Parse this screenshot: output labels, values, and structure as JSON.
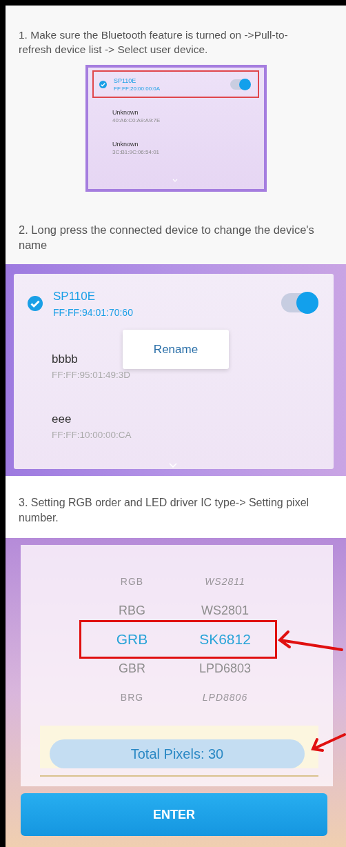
{
  "step1": {
    "text": "1. Make sure the Bluetooth feature is turned on ->Pull-to-refresh device list -> Select user device.",
    "devices": [
      {
        "name": "SP110E",
        "address": "FF:FF:20:00:00:0A",
        "selected": true,
        "connected": true,
        "highlighted": true
      },
      {
        "name": "Unknown",
        "address": "40:A6:C0:A9:A9:7E",
        "selected": false,
        "connected": false,
        "highlighted": false
      },
      {
        "name": "Unknown",
        "address": "3C:B1:9C:06:54:01",
        "selected": false,
        "connected": false,
        "highlighted": false
      }
    ]
  },
  "step2": {
    "text": "2. Long press the connected device to change the device's name",
    "devices": [
      {
        "name": "SP110E",
        "address": "FF:FF:94:01:70:60",
        "selected": true,
        "connected": true
      },
      {
        "name": "bbbb",
        "address": "FF:FF:95:01:49:3D",
        "selected": false,
        "connected": false
      },
      {
        "name": "eee",
        "address": "FF:FF:10:00:00:CA",
        "selected": false,
        "connected": false
      }
    ],
    "menu": {
      "label": "Rename"
    }
  },
  "step3": {
    "text": "3. Setting RGB order and LED driver IC type-> Setting pixel number.",
    "orders": [
      {
        "label": "RGB",
        "selected": false
      },
      {
        "label": "RBG",
        "selected": false
      },
      {
        "label": "GRB",
        "selected": true
      },
      {
        "label": "GBR",
        "selected": false
      },
      {
        "label": "BRG",
        "selected": false
      }
    ],
    "ic_types": [
      {
        "label": "WS2811",
        "selected": false
      },
      {
        "label": "WS2801",
        "selected": false
      },
      {
        "label": "SK6812",
        "selected": true
      },
      {
        "label": "LPD6803",
        "selected": false
      },
      {
        "label": "LPD8806",
        "selected": false
      }
    ],
    "total_pixels": "Total Pixels: 30",
    "button": "ENTER"
  }
}
